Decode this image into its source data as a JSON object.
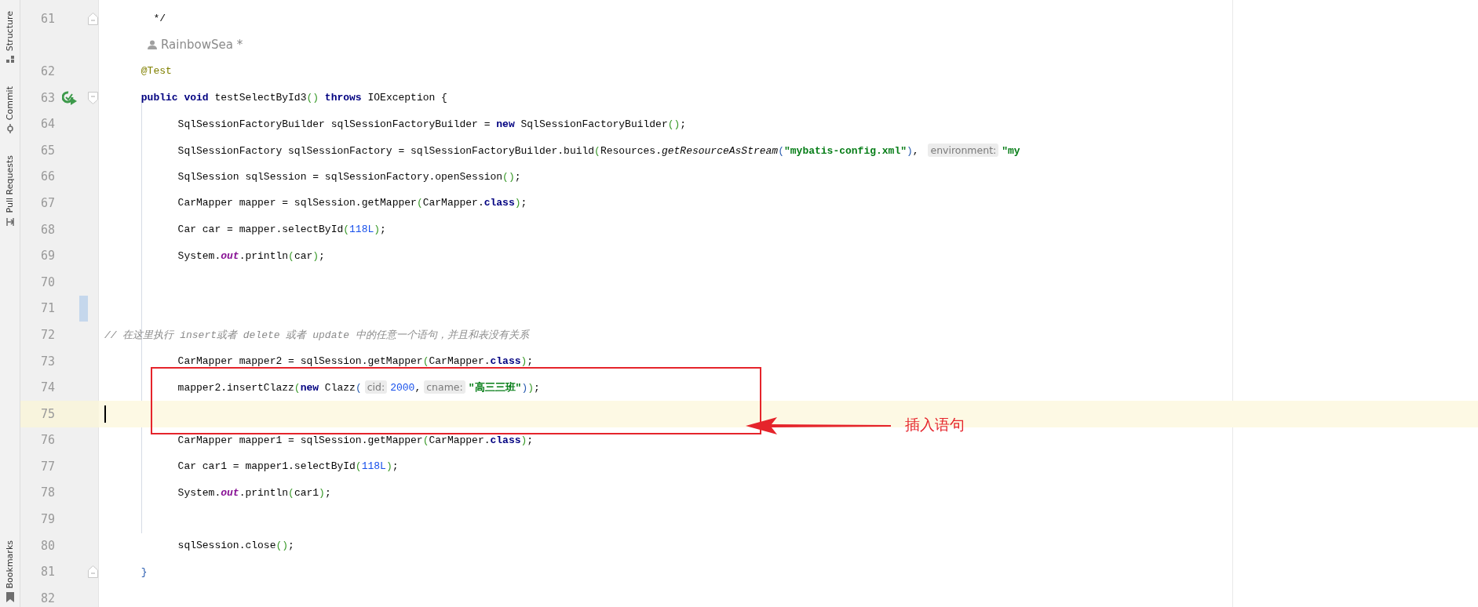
{
  "sidebar": {
    "tools": [
      {
        "label": "Structure"
      },
      {
        "label": "Commit"
      },
      {
        "label": "Pull Requests"
      },
      {
        "label": "Bookmarks"
      }
    ]
  },
  "editor": {
    "lines": [
      {
        "kind": "code",
        "number": "61",
        "gutter_icons": [
          {
            "kind": "fold-end"
          }
        ],
        "changed": false,
        "current": false,
        "tokens": [
          {
            "kind": "plain",
            "text": "        */"
          }
        ]
      },
      {
        "kind": "author",
        "text": "RainbowSea *"
      },
      {
        "kind": "code",
        "number": "62",
        "changed": false,
        "current": false,
        "tokens": [
          {
            "kind": "annotation",
            "text": "      @Test"
          }
        ]
      },
      {
        "kind": "code",
        "number": "63",
        "gutter_icons": [
          {
            "kind": "run"
          },
          {
            "kind": "fold-start"
          }
        ],
        "changed": false,
        "current": false,
        "tokens": [
          {
            "kind": "keyword",
            "text": "      public void"
          },
          {
            "kind": "plain",
            "text": " testSelectById3"
          },
          {
            "kind": "paren1",
            "text": "()"
          },
          {
            "kind": "keyword",
            "text": " throws"
          },
          {
            "kind": "plain",
            "text": " IOException {"
          }
        ]
      },
      {
        "kind": "code",
        "number": "64",
        "changed": false,
        "current": false,
        "tokens": [
          {
            "kind": "plain",
            "text": "            SqlSessionFactoryBuilder sqlSessionFactoryBuilder = "
          },
          {
            "kind": "keyword",
            "text": "new"
          },
          {
            "kind": "plain",
            "text": " SqlSessionFactoryBuilder"
          },
          {
            "kind": "paren1",
            "text": "()"
          },
          {
            "kind": "plain",
            "text": ";"
          }
        ]
      },
      {
        "kind": "code",
        "number": "65",
        "changed": false,
        "current": false,
        "tokens": [
          {
            "kind": "plain",
            "text": "            SqlSessionFactory sqlSessionFactory = sqlSessionFactoryBuilder.build"
          },
          {
            "kind": "paren1",
            "text": "("
          },
          {
            "kind": "plain",
            "text": "Resources."
          },
          {
            "kind": "static",
            "text": "getResourceAsStream"
          },
          {
            "kind": "paren2",
            "text": "("
          },
          {
            "kind": "string",
            "text": "\"mybatis-config.xml\""
          },
          {
            "kind": "paren2",
            "text": ")"
          },
          {
            "kind": "plain",
            "text": ", "
          },
          {
            "kind": "hint",
            "text": "environment:"
          },
          {
            "kind": "string",
            "text": "\"my"
          }
        ]
      },
      {
        "kind": "code",
        "number": "66",
        "changed": false,
        "current": false,
        "tokens": [
          {
            "kind": "plain",
            "text": "            SqlSession sqlSession = sqlSessionFactory.openSession"
          },
          {
            "kind": "paren1",
            "text": "()"
          },
          {
            "kind": "plain",
            "text": ";"
          }
        ]
      },
      {
        "kind": "code",
        "number": "67",
        "changed": false,
        "current": false,
        "tokens": [
          {
            "kind": "plain",
            "text": "            CarMapper mapper = sqlSession.getMapper"
          },
          {
            "kind": "paren1",
            "text": "("
          },
          {
            "kind": "plain",
            "text": "CarMapper."
          },
          {
            "kind": "keyword",
            "text": "class"
          },
          {
            "kind": "paren1",
            "text": ")"
          },
          {
            "kind": "plain",
            "text": ";"
          }
        ]
      },
      {
        "kind": "code",
        "number": "68",
        "changed": false,
        "current": false,
        "tokens": [
          {
            "kind": "plain",
            "text": "            Car car = mapper.selectById"
          },
          {
            "kind": "paren1",
            "text": "("
          },
          {
            "kind": "number",
            "text": "118L"
          },
          {
            "kind": "paren1",
            "text": ")"
          },
          {
            "kind": "plain",
            "text": ";"
          }
        ]
      },
      {
        "kind": "code",
        "number": "69",
        "changed": false,
        "current": false,
        "tokens": [
          {
            "kind": "plain",
            "text": "            System."
          },
          {
            "kind": "field",
            "text": "out"
          },
          {
            "kind": "plain",
            "text": ".println"
          },
          {
            "kind": "paren1",
            "text": "("
          },
          {
            "kind": "plain",
            "text": "car"
          },
          {
            "kind": "paren1",
            "text": ")"
          },
          {
            "kind": "plain",
            "text": ";"
          }
        ]
      },
      {
        "kind": "code",
        "number": "70",
        "changed": false,
        "current": false
      },
      {
        "kind": "code",
        "number": "71",
        "changed": true,
        "current": false
      },
      {
        "kind": "code",
        "number": "72",
        "changed": false,
        "current": false,
        "tokens": [
          {
            "kind": "comment",
            "text": "// 在这里执行 insert或者 delete 或者 update 中的任意一个语句，并且和表没有关系"
          }
        ]
      },
      {
        "kind": "code",
        "number": "73",
        "changed": false,
        "current": false,
        "tokens": [
          {
            "kind": "plain",
            "text": "            CarMapper mapper2 = sqlSession.getMapper"
          },
          {
            "kind": "paren1",
            "text": "("
          },
          {
            "kind": "plain",
            "text": "CarMapper."
          },
          {
            "kind": "keyword",
            "text": "class"
          },
          {
            "kind": "paren1",
            "text": ")"
          },
          {
            "kind": "plain",
            "text": ";"
          }
        ]
      },
      {
        "kind": "code",
        "number": "74",
        "changed": false,
        "current": false,
        "tokens": [
          {
            "kind": "plain",
            "text": "            mapper2.insertClazz"
          },
          {
            "kind": "paren1",
            "text": "("
          },
          {
            "kind": "keyword",
            "text": "new"
          },
          {
            "kind": "plain",
            "text": " Clazz"
          },
          {
            "kind": "paren2",
            "text": "("
          },
          {
            "kind": "hint",
            "text": "cid:"
          },
          {
            "kind": "number",
            "text": "2000"
          },
          {
            "kind": "plain",
            "text": ","
          },
          {
            "kind": "hint",
            "text": "cname:"
          },
          {
            "kind": "string",
            "text": "\"高三三班\""
          },
          {
            "kind": "paren2",
            "text": ")"
          },
          {
            "kind": "paren1",
            "text": ")"
          },
          {
            "kind": "plain",
            "text": ";"
          }
        ]
      },
      {
        "kind": "code",
        "number": "75",
        "changed": false,
        "current": true
      },
      {
        "kind": "code",
        "number": "76",
        "changed": false,
        "current": false,
        "tokens": [
          {
            "kind": "plain",
            "text": "            CarMapper mapper1 = sqlSession.getMapper"
          },
          {
            "kind": "paren1",
            "text": "("
          },
          {
            "kind": "plain",
            "text": "CarMapper."
          },
          {
            "kind": "keyword",
            "text": "class"
          },
          {
            "kind": "paren1",
            "text": ")"
          },
          {
            "kind": "plain",
            "text": ";"
          }
        ]
      },
      {
        "kind": "code",
        "number": "77",
        "changed": false,
        "current": false,
        "tokens": [
          {
            "kind": "plain",
            "text": "            Car car1 = mapper1.selectById"
          },
          {
            "kind": "paren1",
            "text": "("
          },
          {
            "kind": "number",
            "text": "118L"
          },
          {
            "kind": "paren1",
            "text": ")"
          },
          {
            "kind": "plain",
            "text": ";"
          }
        ]
      },
      {
        "kind": "code",
        "number": "78",
        "changed": false,
        "current": false,
        "tokens": [
          {
            "kind": "plain",
            "text": "            System."
          },
          {
            "kind": "field",
            "text": "out"
          },
          {
            "kind": "plain",
            "text": ".println"
          },
          {
            "kind": "paren1",
            "text": "("
          },
          {
            "kind": "plain",
            "text": "car1"
          },
          {
            "kind": "paren1",
            "text": ")"
          },
          {
            "kind": "plain",
            "text": ";"
          }
        ]
      },
      {
        "kind": "code",
        "number": "79",
        "changed": false,
        "current": false
      },
      {
        "kind": "code",
        "number": "80",
        "changed": false,
        "current": false,
        "tokens": [
          {
            "kind": "plain",
            "text": "            sqlSession.close"
          },
          {
            "kind": "paren1",
            "text": "()"
          },
          {
            "kind": "plain",
            "text": ";"
          }
        ]
      },
      {
        "kind": "code",
        "number": "81",
        "gutter_icons": [
          {
            "kind": "fold-end"
          }
        ],
        "changed": false,
        "current": false,
        "tokens": [
          {
            "kind": "paren2",
            "text": "      }"
          }
        ]
      },
      {
        "kind": "code",
        "number": "82",
        "changed": false,
        "current": false
      }
    ]
  },
  "callout": {
    "label": "插入语句"
  }
}
